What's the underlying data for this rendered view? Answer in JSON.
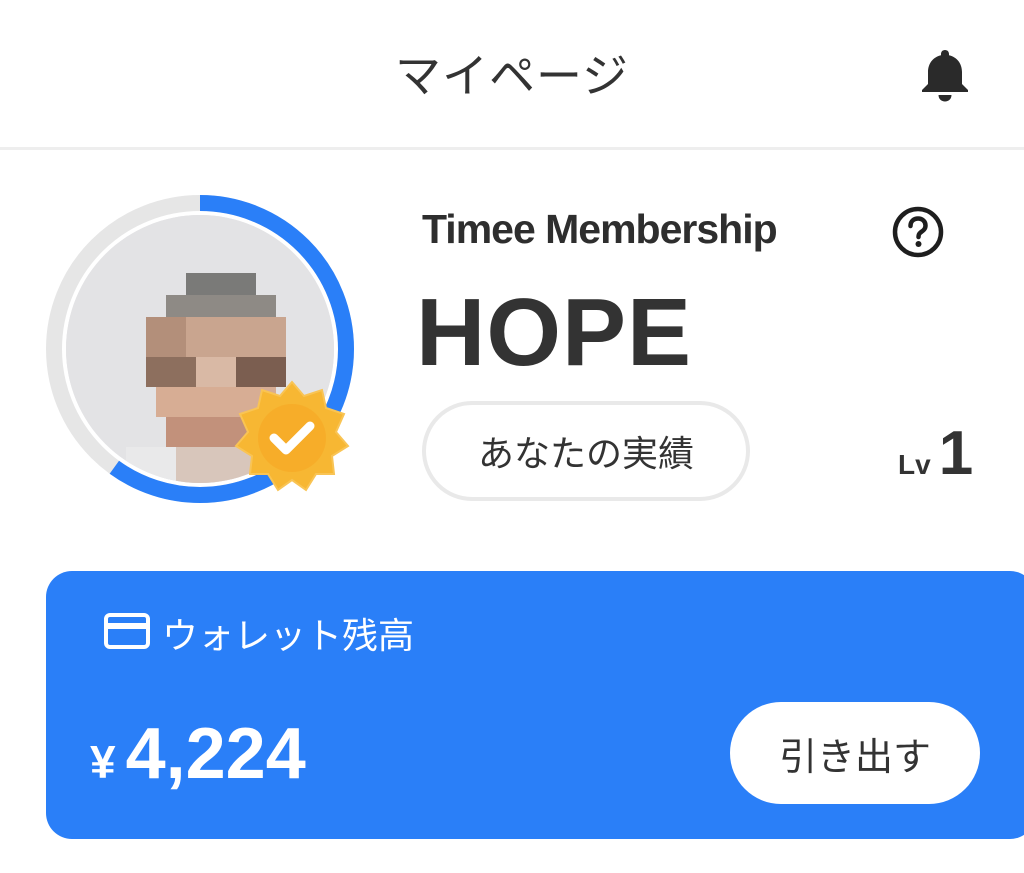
{
  "header": {
    "title": "マイページ",
    "notification_icon": "bell-icon"
  },
  "profile": {
    "membership_title": "Timee Membership",
    "help_icon": "question-circle-icon",
    "rank": "HOPE",
    "achievements_label": "あなたの実績",
    "level_prefix": "Lv",
    "level": "1",
    "verified_badge_icon": "verified-check-badge-icon"
  },
  "wallet": {
    "icon": "credit-card-icon",
    "label": "ウォレット残高",
    "currency": "¥",
    "balance": "4,224",
    "withdraw_label": "引き出す"
  },
  "colors": {
    "accent": "#2a7ff8",
    "ring_inactive": "#e6e6e6",
    "badge": "#f7b733",
    "text": "#333333"
  }
}
